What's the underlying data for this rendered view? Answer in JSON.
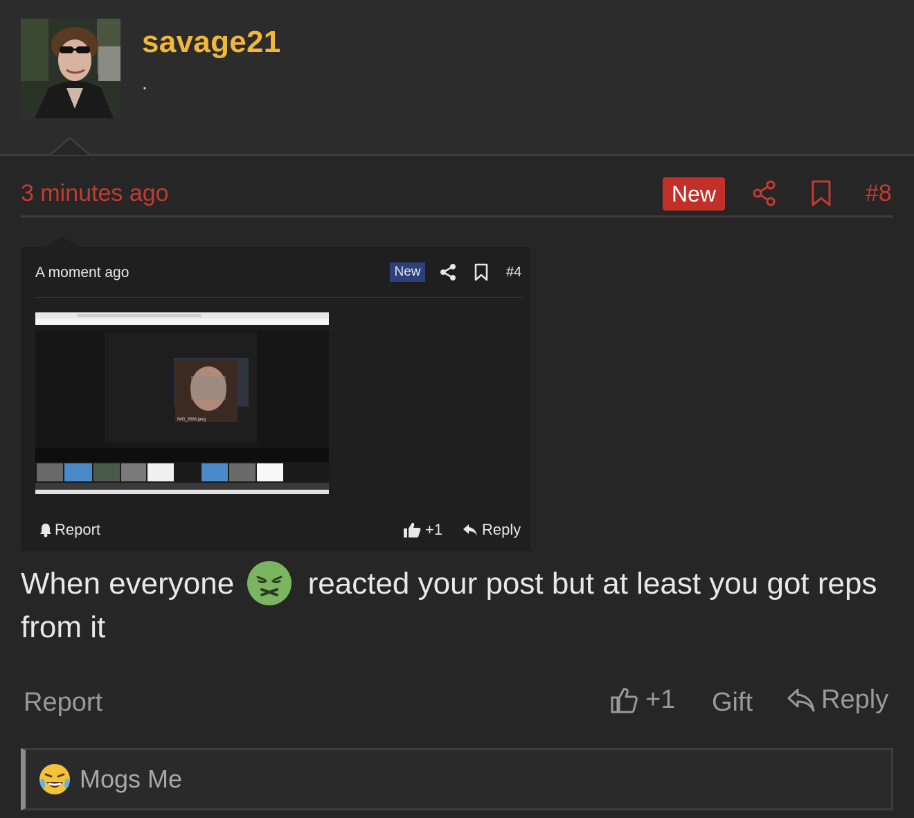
{
  "user": {
    "name": "savage21",
    "title": "."
  },
  "post": {
    "time_ago": "3 minutes ago",
    "new_label": "New",
    "number": "#8",
    "body_before_emoji": "When everyone",
    "body_after_emoji": "reacted your post but at least you got reps from it",
    "actions": {
      "report": "Report",
      "like_count": "+1",
      "gift": "Gift",
      "reply": "Reply"
    }
  },
  "quoted_post": {
    "time_ago": "A moment ago",
    "new_label": "New",
    "number": "#4",
    "image_caption": "IMG_3568.jpeg",
    "actions": {
      "report": "Report",
      "like_count": "+1",
      "reply": "Reply"
    }
  },
  "reactions": {
    "label": "Mogs Me"
  },
  "colors": {
    "username": "#f0b83a",
    "accent_red": "#c33b30",
    "new_badge_bg": "#c3302a",
    "quoted_new_bg": "#2d3f7d",
    "background": "#262626"
  }
}
